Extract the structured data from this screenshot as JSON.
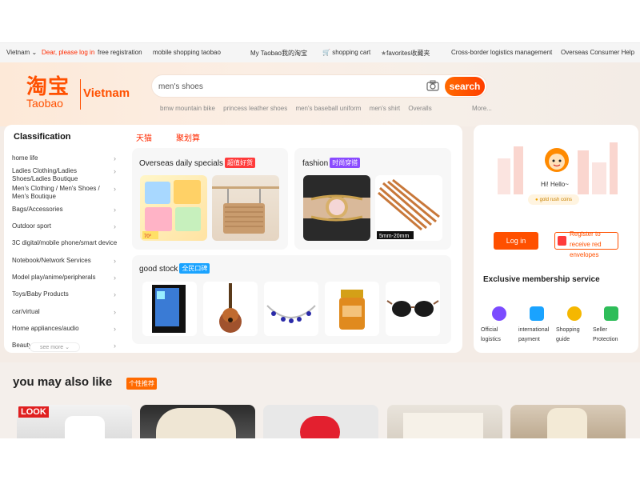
{
  "topbar": {
    "country": "Vietnam",
    "login_prompt": "Dear, please log in",
    "register": "free registration",
    "mobile": "mobile shopping taobao",
    "my_taobao": "My Taobao我的淘宝",
    "cart": "shopping cart",
    "favorites": "favorites收藏夹",
    "logistics": "Cross-border logistics management",
    "help": "Overseas Consumer Help"
  },
  "logo": {
    "cn": "淘宝",
    "en": "Taobao",
    "country": "Vietnam"
  },
  "search": {
    "value": "men's shoes",
    "button": "search",
    "hot_words": [
      "bmw mountain bike",
      "princess leather shoes",
      "men's baseball uniform",
      "men's shirt",
      "Overalls",
      "More..."
    ]
  },
  "classification": {
    "title": "Classification",
    "items": [
      "home life",
      "Ladies Clothing/Ladies Shoes/Ladies Boutique",
      "Men's Clothing / Men's Shoes / Men's Boutique",
      "Bags/Accessories",
      "Outdoor sport",
      "3C digital/mobile phone/smart device",
      "Notebook/Network Services",
      "Model play/anime/peripherals",
      "Toys/Baby Products",
      "car/virtual",
      "Home appliances/audio",
      "Beauty"
    ],
    "see_more": "see more"
  },
  "brand_tabs": [
    "天猫",
    "聚划算"
  ],
  "cards": {
    "overseas": {
      "title": "Overseas daily specials",
      "tag": "超值好货"
    },
    "fashion": {
      "title": "fashion",
      "tag": "时尚穿搭",
      "caption": "5mm-20mm"
    },
    "good_stock": {
      "title": "good stock",
      "tag": "全民口碑"
    }
  },
  "user": {
    "hello": "Hi! Hello~",
    "coins": "gold rush coins",
    "login": "Log in",
    "register": "Register to receive red envelopes",
    "membership_title": "Exclusive membership service",
    "services": [
      "Official logistics",
      "international payment",
      "Shopping guide",
      "Seller Protection"
    ]
  },
  "may_like": {
    "title": "you may also like",
    "tag": "个性推荐",
    "first_label": "LOOK"
  },
  "colors": {
    "brand": "#ff5000",
    "accent_red": "#ff3b3b",
    "purple": "#8a4bff",
    "blue": "#1aa3ff"
  }
}
